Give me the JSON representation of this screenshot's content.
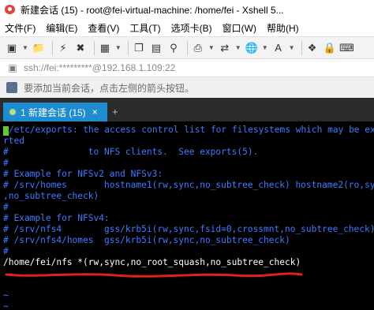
{
  "window": {
    "title": "新建会话 (15) - root@fei-virtual-machine: /home/fei - Xshell 5..."
  },
  "menu": {
    "items": [
      "文件(F)",
      "编辑(E)",
      "查看(V)",
      "工具(T)",
      "选项卡(B)",
      "窗口(W)",
      "帮助(H)"
    ]
  },
  "address": {
    "text": "ssh://fei:*********@192.168.1.109:22"
  },
  "hint": {
    "text": "要添加当前会话，点击左侧的箭头按钮。"
  },
  "tab": {
    "label": "1 新建会话 (15)",
    "close": "×",
    "add": "+"
  },
  "terminal": {
    "lines": [
      "/etc/exports: the access control list for filesystems which may be expo",
      "rted",
      "#               to NFS clients.  See exports(5).",
      "#",
      "# Example for NFSv2 and NFSv3:",
      "# /srv/homes       hostname1(rw,sync,no_subtree_check) hostname2(ro,sync",
      ",no_subtree_check)",
      "#",
      "# Example for NFSv4:",
      "# /srv/nfs4        gss/krb5i(rw,sync,fsid=0,crossmnt,no_subtree_check)",
      "# /srv/nfs4/homes  gss/krb5i(rw,sync,no_subtree_check)",
      "#",
      "/home/fei/nfs *(rw,sync,no_root_squash,no_subtree_check)",
      "",
      "~",
      "~"
    ],
    "colors": {
      "background": "#000000",
      "comment": "#3d7aff",
      "text": "#ffffff",
      "cursor": "#5ecc2a",
      "annotation": "#e0211a"
    }
  },
  "colors": {
    "tab_active": "#1e8ccf",
    "tabbar_bg": "#2b2b2b"
  }
}
